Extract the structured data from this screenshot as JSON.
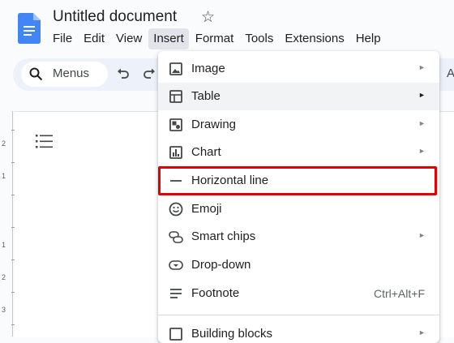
{
  "doc": {
    "title": "Untitled document"
  },
  "menubar": [
    "File",
    "Edit",
    "View",
    "Insert",
    "Format",
    "Tools",
    "Extensions",
    "Help"
  ],
  "toolbar": {
    "search_label": "Menus",
    "partial_label": "A"
  },
  "ruler": [
    "2",
    "1",
    "1",
    "2",
    "3"
  ],
  "insert_menu": {
    "items": [
      {
        "label": "Image",
        "icon": "image-icon",
        "submenu": true
      },
      {
        "label": "Table",
        "icon": "table-icon",
        "submenu": true
      },
      {
        "label": "Drawing",
        "icon": "drawing-icon",
        "submenu": true
      },
      {
        "label": "Chart",
        "icon": "chart-icon",
        "submenu": true
      },
      {
        "label": "Horizontal line",
        "icon": "horizontal-line-icon",
        "submenu": false
      },
      {
        "label": "Emoji",
        "icon": "emoji-icon",
        "submenu": false
      },
      {
        "label": "Smart chips",
        "icon": "smart-chips-icon",
        "submenu": true
      },
      {
        "label": "Drop-down",
        "icon": "dropdown-icon",
        "submenu": false
      },
      {
        "label": "Footnote",
        "icon": "footnote-icon",
        "submenu": false,
        "shortcut": "Ctrl+Alt+F"
      },
      {
        "label": "Building blocks",
        "icon": "building-blocks-icon",
        "submenu": true
      }
    ],
    "arrow": "►"
  },
  "colors": {
    "accent": "#1a73e8",
    "highlight": "#e50000"
  }
}
